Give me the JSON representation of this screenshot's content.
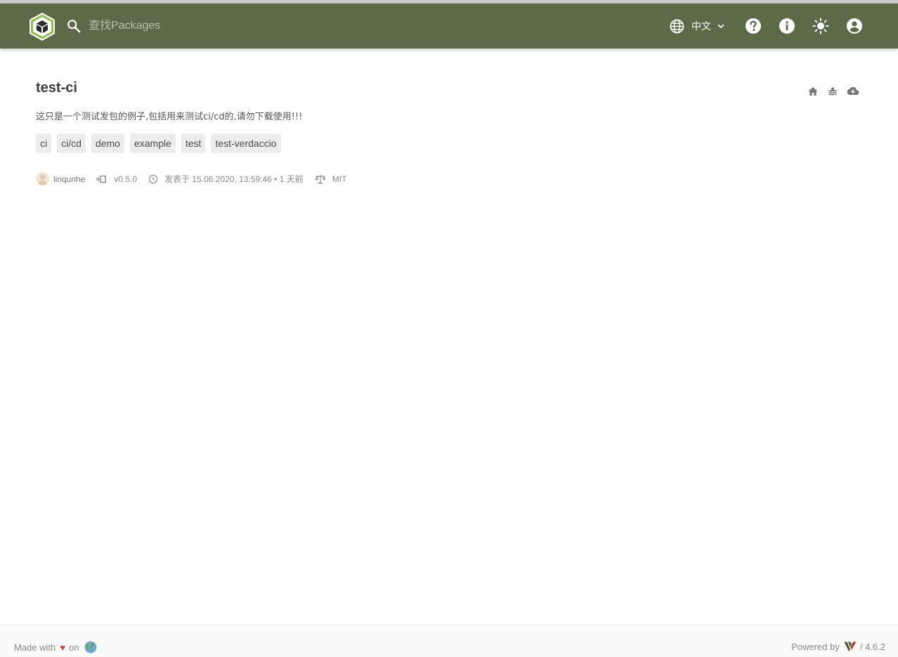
{
  "header": {
    "search_placeholder": "查找Packages",
    "language_label": "中文",
    "icons": [
      "verdaccio-logo-icon",
      "search-icon",
      "globe-icon",
      "chevron-down-icon",
      "help-icon",
      "info-icon",
      "theme-light-icon",
      "account-icon"
    ],
    "bar_color": "#5b6b48"
  },
  "package": {
    "name": "test-ci",
    "description": "这只是一个测试发包的例子,包括用来测试ci/cd的,请勿下载使用!!!",
    "keywords": [
      "ci",
      "ci/cd",
      "demo",
      "example",
      "test",
      "test-verdaccio"
    ],
    "author": "linqunhe",
    "version": "v0.5.0",
    "published": "发表于 15.06.2020, 13:59:46 • 1 天前",
    "license": "MIT",
    "action_icons": [
      "home-icon",
      "bug-icon",
      "cloud-download-icon"
    ]
  },
  "footer": {
    "made_with": "Made with",
    "on": "on",
    "powered_by": "Powered by",
    "version": "/ 4.6.2"
  }
}
